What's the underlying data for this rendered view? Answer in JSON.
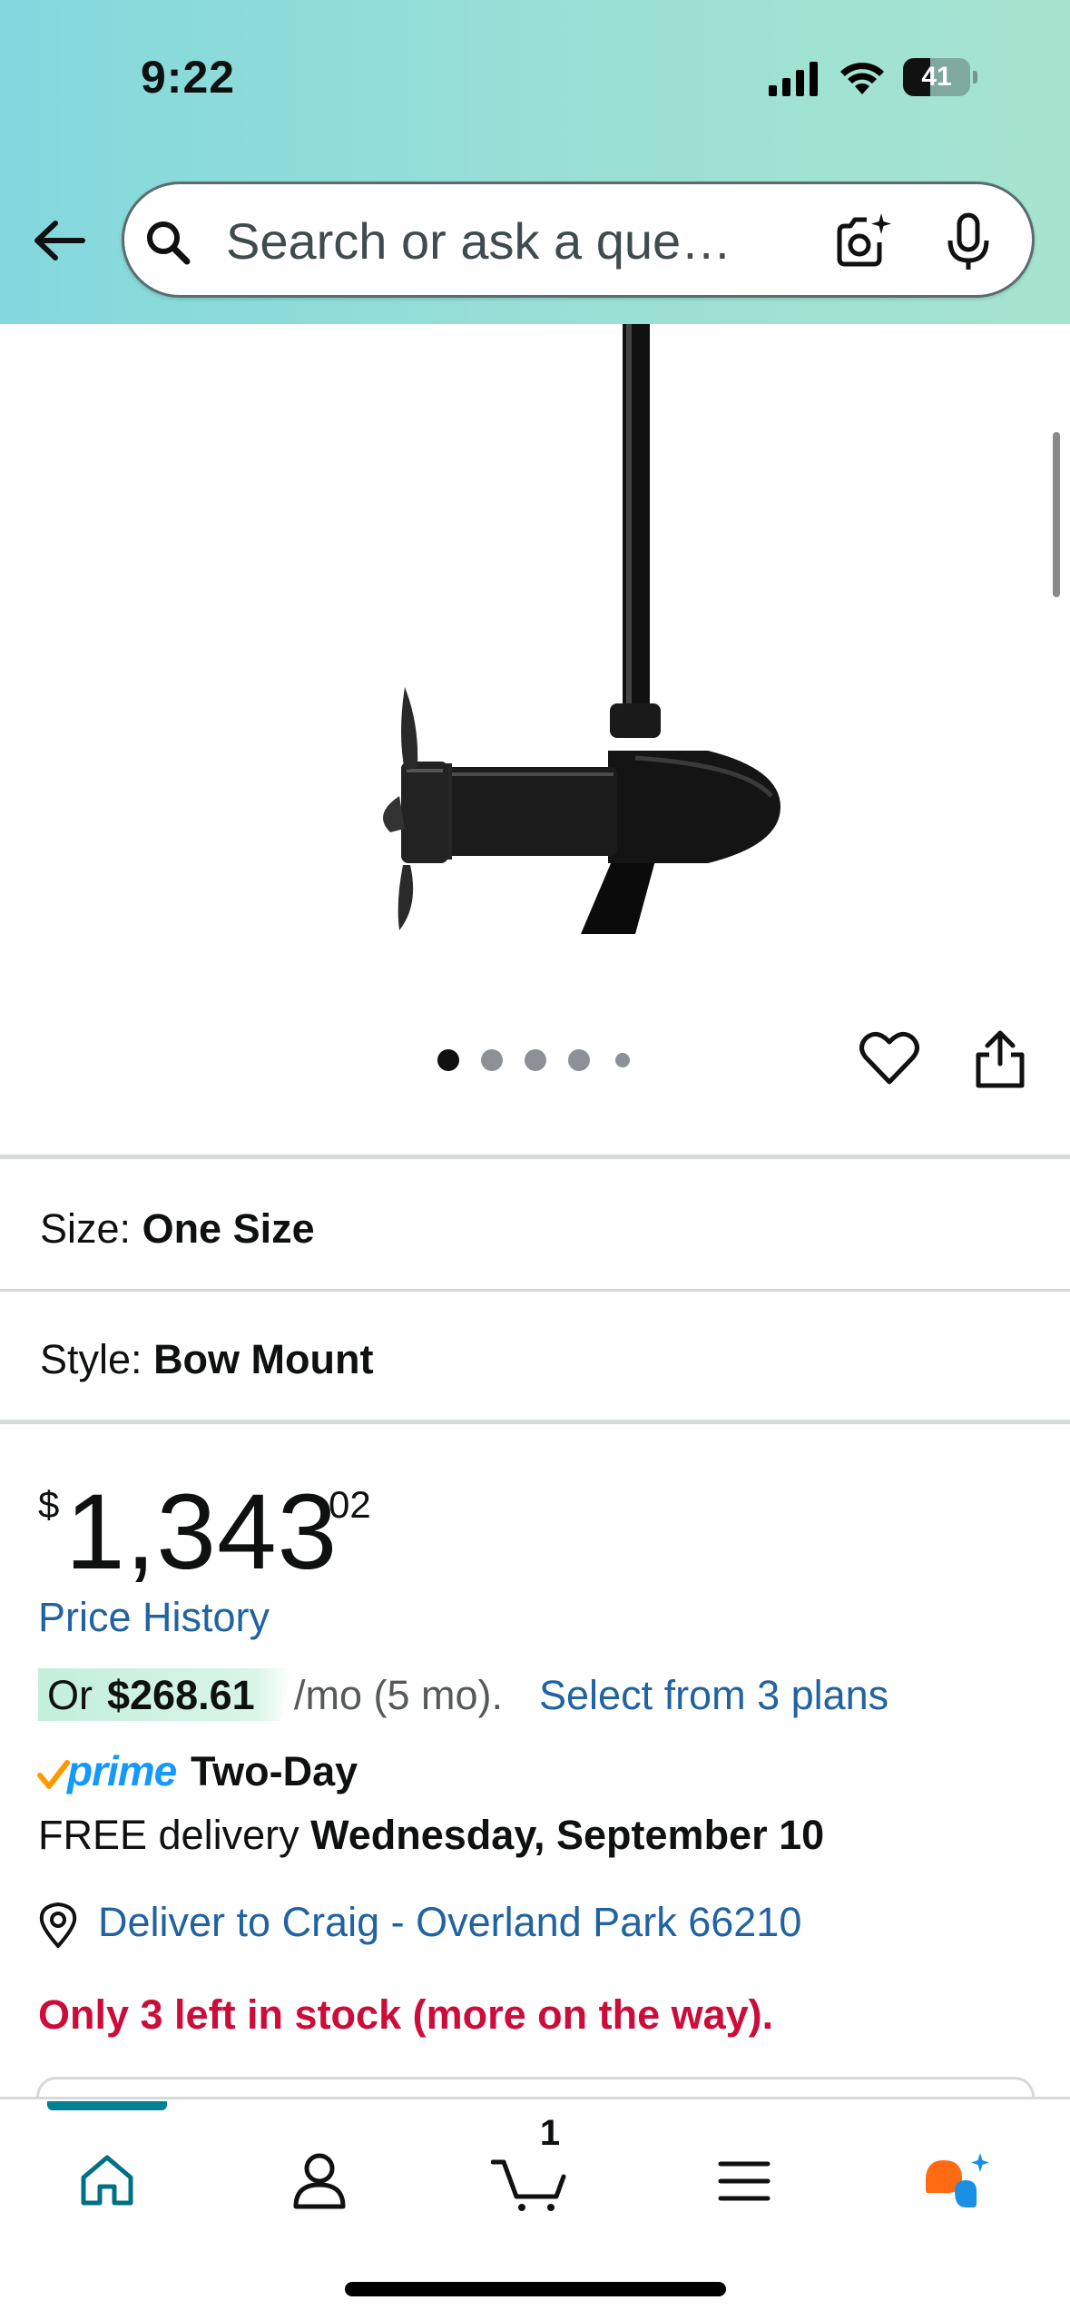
{
  "status_bar": {
    "time": "9:22",
    "battery_level": "41",
    "battery_fraction": 0.41
  },
  "search": {
    "placeholder": "Search or ask a que…"
  },
  "gallery": {
    "image_count": 5,
    "active_index": 0
  },
  "options": {
    "size_label": "Size:",
    "size_value": "One Size",
    "style_label": "Style:",
    "style_value": "Bow Mount"
  },
  "price": {
    "symbol": "$",
    "whole": "1,343",
    "fraction": "02",
    "history_link": "Price History"
  },
  "installment": {
    "or": "Or",
    "amount": "$268.61",
    "terms": "/mo (5 mo).",
    "plans_link": "Select from 3 plans"
  },
  "prime": {
    "word": "prime",
    "speed": "Two-Day"
  },
  "delivery": {
    "prefix": "FREE delivery",
    "date": "Wednesday, September 10"
  },
  "location": {
    "text": "Deliver to Craig - Overland Park 66210"
  },
  "stock": {
    "text": "Only 3 left in stock (more on the way)."
  },
  "bottom_nav": {
    "active": "home",
    "cart_count": "1",
    "items": [
      "home-icon",
      "profile-icon",
      "cart-icon",
      "menu-icon",
      "rufus-icon"
    ]
  },
  "colors": {
    "header_gradient_start": "#83d8dd",
    "header_gradient_end": "#a7e4cf",
    "link": "#2162a1",
    "stock_red": "#cc0c39",
    "prime_blue": "#1399ff",
    "prime_check": "#ff9900",
    "nav_active": "#008296"
  }
}
